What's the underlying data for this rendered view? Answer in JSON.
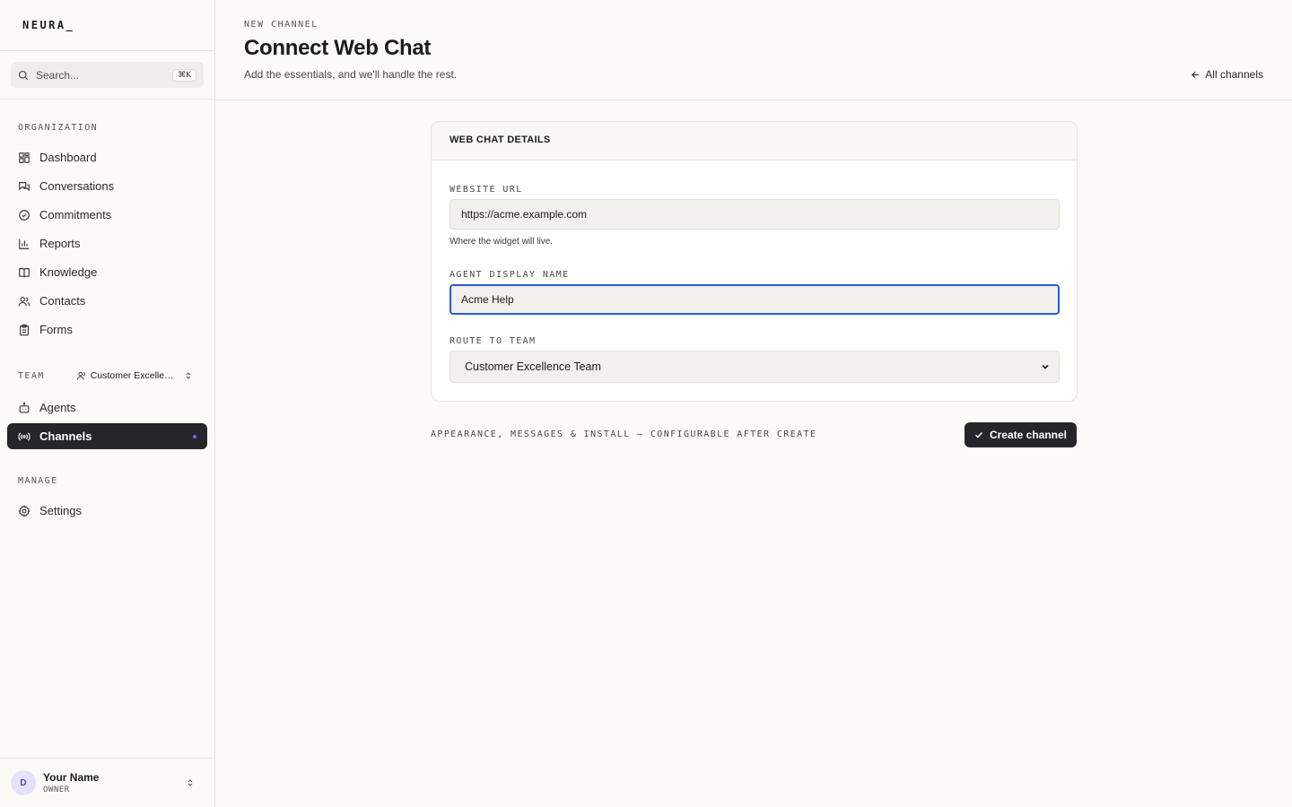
{
  "app": {
    "logo": "NEURA_"
  },
  "search": {
    "placeholder": "Search...",
    "shortcut": "⌘K"
  },
  "sidebar": {
    "organization_label": "ORGANIZATION",
    "org_items": [
      {
        "label": "Dashboard",
        "icon": "dashboard-icon"
      },
      {
        "label": "Conversations",
        "icon": "conversations-icon"
      },
      {
        "label": "Commitments",
        "icon": "check-circle-icon"
      },
      {
        "label": "Reports",
        "icon": "bar-chart-icon"
      },
      {
        "label": "Knowledge",
        "icon": "book-icon"
      },
      {
        "label": "Contacts",
        "icon": "users-icon"
      },
      {
        "label": "Forms",
        "icon": "clipboard-icon"
      }
    ],
    "team_label": "TEAM",
    "team_selected": "Customer Excellence Team",
    "team_items": [
      {
        "label": "Agents",
        "icon": "bot-icon"
      },
      {
        "label": "Channels",
        "icon": "radio-icon",
        "active": true
      }
    ],
    "manage_label": "MANAGE",
    "manage_items": [
      {
        "label": "Settings",
        "icon": "gear-icon"
      }
    ]
  },
  "user": {
    "initial": "D",
    "name": "Your Name",
    "role": "OWNER"
  },
  "header": {
    "eyebrow": "NEW CHANNEL",
    "title": "Connect Web Chat",
    "subtitle": "Add the essentials, and we'll handle the rest.",
    "back_link": "All channels"
  },
  "card": {
    "title": "WEB CHAT DETAILS",
    "website_url": {
      "label": "WEBSITE URL",
      "value": "https://acme.example.com",
      "help": "Where the widget will live."
    },
    "agent_display_name": {
      "label": "AGENT DISPLAY NAME",
      "value": "Acme Help"
    },
    "route_to_team": {
      "label": "ROUTE TO TEAM",
      "value": "Customer Excellence Team"
    }
  },
  "footer": {
    "note": "APPEARANCE, MESSAGES & INSTALL — CONFIGURABLE AFTER CREATE",
    "create_label": "Create channel"
  },
  "colors": {
    "accent": "#2a5bd7",
    "dark": "#26262a",
    "dot": "#6b68ff"
  }
}
